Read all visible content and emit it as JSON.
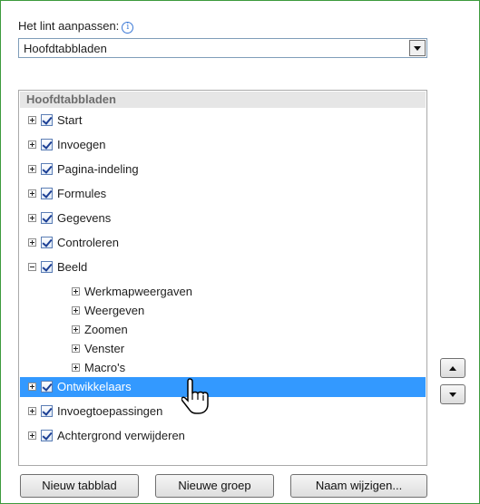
{
  "label": {
    "prefix": "Het lint aanpassen:",
    "info_icon": "i"
  },
  "dropdown": {
    "value": "Hoofdtabbladen"
  },
  "tree": {
    "header": "Hoofdtabbladen",
    "items": [
      {
        "label": "Start",
        "level": 0,
        "expanded": false,
        "checked": true,
        "selected": false
      },
      {
        "label": "Invoegen",
        "level": 0,
        "expanded": false,
        "checked": true,
        "selected": false
      },
      {
        "label": "Pagina-indeling",
        "level": 0,
        "expanded": false,
        "checked": true,
        "selected": false
      },
      {
        "label": "Formules",
        "level": 0,
        "expanded": false,
        "checked": true,
        "selected": false
      },
      {
        "label": "Gegevens",
        "level": 0,
        "expanded": false,
        "checked": true,
        "selected": false
      },
      {
        "label": "Controleren",
        "level": 0,
        "expanded": false,
        "checked": true,
        "selected": false
      },
      {
        "label": "Beeld",
        "level": 0,
        "expanded": true,
        "checked": true,
        "selected": false
      },
      {
        "label": "Werkmapweergaven",
        "level": 1
      },
      {
        "label": "Weergeven",
        "level": 1
      },
      {
        "label": "Zoomen",
        "level": 1
      },
      {
        "label": "Venster",
        "level": 1
      },
      {
        "label": "Macro's",
        "level": 1
      },
      {
        "label": "Ontwikkelaars",
        "level": 0,
        "expanded": false,
        "checked": true,
        "selected": true
      },
      {
        "label": "Invoegtoepassingen",
        "level": 0,
        "expanded": false,
        "checked": true,
        "selected": false
      },
      {
        "label": "Achtergrond verwijderen",
        "level": 0,
        "expanded": false,
        "checked": true,
        "selected": false
      }
    ]
  },
  "buttons": {
    "new_tab": "Nieuw tabblad",
    "new_group": "Nieuwe groep",
    "rename": "Naam wijzigen..."
  },
  "colors": {
    "selection": "#3399ff",
    "frame": "#3d9a3d"
  }
}
